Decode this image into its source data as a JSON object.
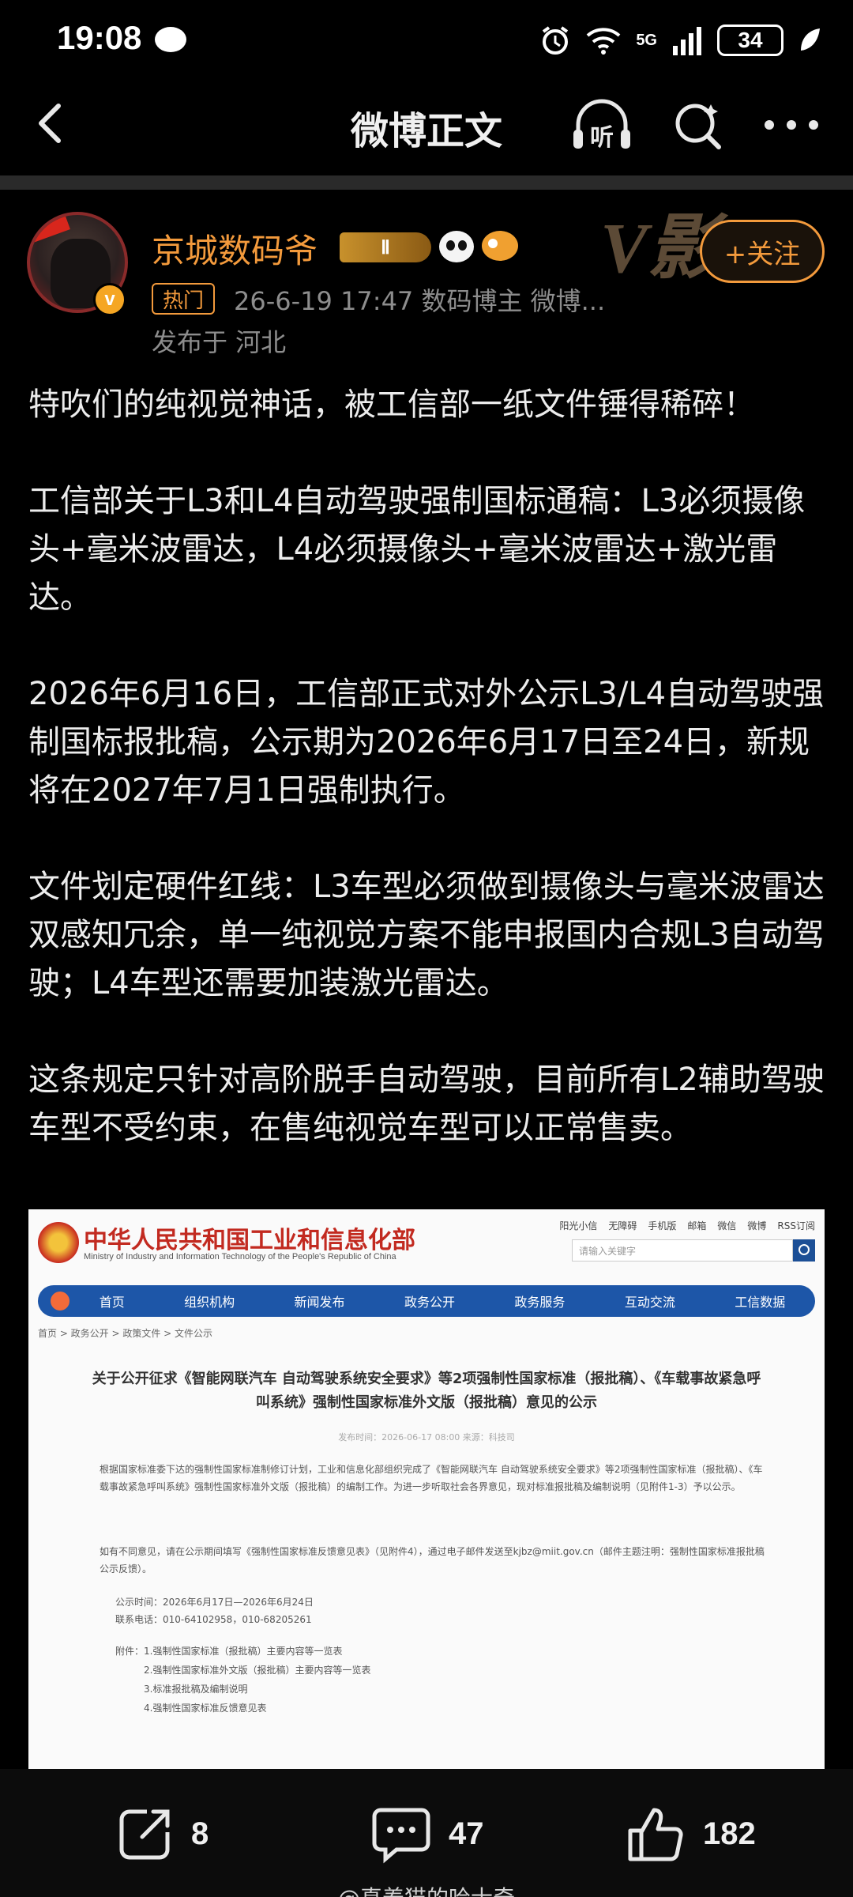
{
  "status_bar": {
    "time": "19:08",
    "network_label": "5G",
    "battery_level": "34",
    "icons": [
      "message-bubble-icon",
      "alarm-icon",
      "wifi-icon",
      "signal-icon",
      "battery-icon",
      "leaf-icon"
    ]
  },
  "nav": {
    "title": "微博正文",
    "listen_label": "听",
    "icons": [
      "back-arrow-icon",
      "listen-headphone-icon",
      "search-icon",
      "more-dots-icon"
    ]
  },
  "author": {
    "name": "京城数码爷",
    "rank_badge": "Ⅱ",
    "verified_badge": "v",
    "vip_watermark": "V影",
    "follow_label": "+关注",
    "hot_tag": "热门",
    "meta": "26-6-19 17:47  数码博主 微博...",
    "location": "发布于 河北",
    "accent_color": "#f39a3c"
  },
  "post": {
    "paragraphs": [
      "特吹们的纯视觉神话，被工信部一纸文件锤得稀碎！",
      "工信部关于L3和L4自动驾驶强制国标通稿：L3必须摄像头+毫米波雷达，L4必须摄像头+毫米波雷达+激光雷达。",
      "2026年6月16日，工信部正式对外公示L3/L4自动驾驶强制国标报批稿，公示期为2026年6月17日至24日，新规将在2027年7月1日强制执行。",
      "文件划定硬件红线：L3车型必须做到摄像头与毫米波雷达双感知冗余，单一纯视觉方案不能申报国内合规L3自动驾驶；L4车型还需要加装激光雷达。",
      "这条规定只针对高阶脱手自动驾驶，目前所有L2辅助驾驶车型不受约束，在售纯视觉车型可以正常售卖。"
    ]
  },
  "embedded_image": {
    "site_title": "中华人民共和国工业和信息化部",
    "site_subtitle": "Ministry of Industry and Information Technology of the People's Republic of China",
    "top_links": [
      "阳光小信",
      "无障碍",
      "手机版",
      "邮箱",
      "微信",
      "微博",
      "RSS订阅"
    ],
    "search_placeholder": "请输入关键字",
    "nav_items": [
      "首页",
      "组织机构",
      "新闻发布",
      "政务公开",
      "政务服务",
      "互动交流",
      "工信数据"
    ],
    "breadcrumb": "首页 > 政务公开 > 政策文件 > 文件公示",
    "doc_title": "关于公开征求《智能网联汽车 自动驾驶系统安全要求》等2项强制性国家标准（报批稿）、《车载事故紧急呼叫系统》强制性国家标准外文版（报批稿）意见的公示",
    "doc_date": "发布时间：2026-06-17 08:00    来源：科技司",
    "paragraph_1": "根据国家标准委下达的强制性国家标准制修订计划，工业和信息化部组织完成了《智能网联汽车 自动驾驶系统安全要求》等2项强制性国家标准（报批稿）、《车载事故紧急呼叫系统》强制性国家标准外文版（报批稿）的编制工作。为进一步听取社会各界意见，现对标准报批稿及编制说明（见附件1-3）予以公示。",
    "paragraph_2": "如有不同意见，请在公示期间填写《强制性国家标准反馈意见表》（见附件4），通过电子邮件发送至kjbz@miit.gov.cn（邮件主题注明：强制性国家标准报批稿公示反馈）。",
    "notice_period": "公示时间：2026年6月17日—2026年6月24日",
    "phone": "联系电话：010-64102958，010-68205261",
    "attachments": [
      "附件：1.强制性国家标准（报批稿）主要内容等一览表",
      "2.强制性国家标准外文版（报批稿）主要内容等一览表",
      "3.标准报批稿及编制说明",
      "4.强制性国家标准反馈意见表"
    ]
  },
  "actions": {
    "share_count": "8",
    "comment_count": "47",
    "like_count": "182"
  },
  "watermark": "@真养猫的哈士奇"
}
